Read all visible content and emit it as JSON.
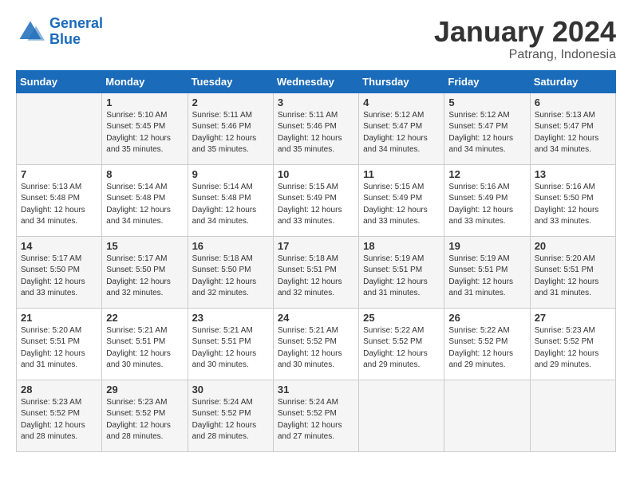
{
  "logo": {
    "line1": "General",
    "line2": "Blue"
  },
  "title": "January 2024",
  "location": "Patrang, Indonesia",
  "days_header": [
    "Sunday",
    "Monday",
    "Tuesday",
    "Wednesday",
    "Thursday",
    "Friday",
    "Saturday"
  ],
  "weeks": [
    [
      {
        "day": "",
        "info": ""
      },
      {
        "day": "1",
        "info": "Sunrise: 5:10 AM\nSunset: 5:45 PM\nDaylight: 12 hours\nand 35 minutes."
      },
      {
        "day": "2",
        "info": "Sunrise: 5:11 AM\nSunset: 5:46 PM\nDaylight: 12 hours\nand 35 minutes."
      },
      {
        "day": "3",
        "info": "Sunrise: 5:11 AM\nSunset: 5:46 PM\nDaylight: 12 hours\nand 35 minutes."
      },
      {
        "day": "4",
        "info": "Sunrise: 5:12 AM\nSunset: 5:47 PM\nDaylight: 12 hours\nand 34 minutes."
      },
      {
        "day": "5",
        "info": "Sunrise: 5:12 AM\nSunset: 5:47 PM\nDaylight: 12 hours\nand 34 minutes."
      },
      {
        "day": "6",
        "info": "Sunrise: 5:13 AM\nSunset: 5:47 PM\nDaylight: 12 hours\nand 34 minutes."
      }
    ],
    [
      {
        "day": "7",
        "info": "Sunrise: 5:13 AM\nSunset: 5:48 PM\nDaylight: 12 hours\nand 34 minutes."
      },
      {
        "day": "8",
        "info": "Sunrise: 5:14 AM\nSunset: 5:48 PM\nDaylight: 12 hours\nand 34 minutes."
      },
      {
        "day": "9",
        "info": "Sunrise: 5:14 AM\nSunset: 5:48 PM\nDaylight: 12 hours\nand 34 minutes."
      },
      {
        "day": "10",
        "info": "Sunrise: 5:15 AM\nSunset: 5:49 PM\nDaylight: 12 hours\nand 33 minutes."
      },
      {
        "day": "11",
        "info": "Sunrise: 5:15 AM\nSunset: 5:49 PM\nDaylight: 12 hours\nand 33 minutes."
      },
      {
        "day": "12",
        "info": "Sunrise: 5:16 AM\nSunset: 5:49 PM\nDaylight: 12 hours\nand 33 minutes."
      },
      {
        "day": "13",
        "info": "Sunrise: 5:16 AM\nSunset: 5:50 PM\nDaylight: 12 hours\nand 33 minutes."
      }
    ],
    [
      {
        "day": "14",
        "info": "Sunrise: 5:17 AM\nSunset: 5:50 PM\nDaylight: 12 hours\nand 33 minutes."
      },
      {
        "day": "15",
        "info": "Sunrise: 5:17 AM\nSunset: 5:50 PM\nDaylight: 12 hours\nand 32 minutes."
      },
      {
        "day": "16",
        "info": "Sunrise: 5:18 AM\nSunset: 5:50 PM\nDaylight: 12 hours\nand 32 minutes."
      },
      {
        "day": "17",
        "info": "Sunrise: 5:18 AM\nSunset: 5:51 PM\nDaylight: 12 hours\nand 32 minutes."
      },
      {
        "day": "18",
        "info": "Sunrise: 5:19 AM\nSunset: 5:51 PM\nDaylight: 12 hours\nand 31 minutes."
      },
      {
        "day": "19",
        "info": "Sunrise: 5:19 AM\nSunset: 5:51 PM\nDaylight: 12 hours\nand 31 minutes."
      },
      {
        "day": "20",
        "info": "Sunrise: 5:20 AM\nSunset: 5:51 PM\nDaylight: 12 hours\nand 31 minutes."
      }
    ],
    [
      {
        "day": "21",
        "info": "Sunrise: 5:20 AM\nSunset: 5:51 PM\nDaylight: 12 hours\nand 31 minutes."
      },
      {
        "day": "22",
        "info": "Sunrise: 5:21 AM\nSunset: 5:51 PM\nDaylight: 12 hours\nand 30 minutes."
      },
      {
        "day": "23",
        "info": "Sunrise: 5:21 AM\nSunset: 5:51 PM\nDaylight: 12 hours\nand 30 minutes."
      },
      {
        "day": "24",
        "info": "Sunrise: 5:21 AM\nSunset: 5:52 PM\nDaylight: 12 hours\nand 30 minutes."
      },
      {
        "day": "25",
        "info": "Sunrise: 5:22 AM\nSunset: 5:52 PM\nDaylight: 12 hours\nand 29 minutes."
      },
      {
        "day": "26",
        "info": "Sunrise: 5:22 AM\nSunset: 5:52 PM\nDaylight: 12 hours\nand 29 minutes."
      },
      {
        "day": "27",
        "info": "Sunrise: 5:23 AM\nSunset: 5:52 PM\nDaylight: 12 hours\nand 29 minutes."
      }
    ],
    [
      {
        "day": "28",
        "info": "Sunrise: 5:23 AM\nSunset: 5:52 PM\nDaylight: 12 hours\nand 28 minutes."
      },
      {
        "day": "29",
        "info": "Sunrise: 5:23 AM\nSunset: 5:52 PM\nDaylight: 12 hours\nand 28 minutes."
      },
      {
        "day": "30",
        "info": "Sunrise: 5:24 AM\nSunset: 5:52 PM\nDaylight: 12 hours\nand 28 minutes."
      },
      {
        "day": "31",
        "info": "Sunrise: 5:24 AM\nSunset: 5:52 PM\nDaylight: 12 hours\nand 27 minutes."
      },
      {
        "day": "",
        "info": ""
      },
      {
        "day": "",
        "info": ""
      },
      {
        "day": "",
        "info": ""
      }
    ]
  ]
}
